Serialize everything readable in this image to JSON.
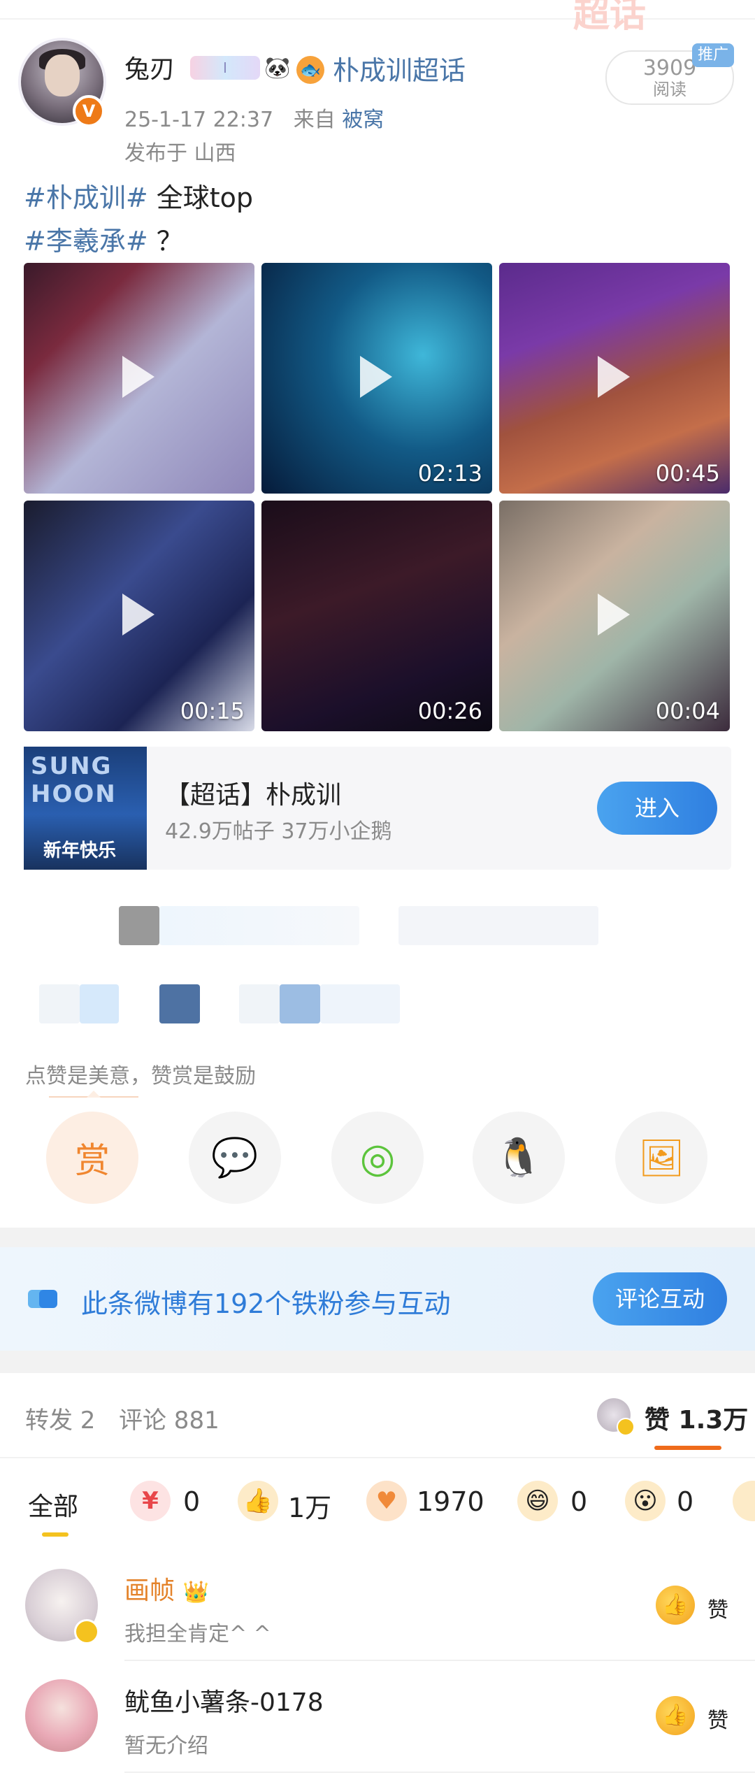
{
  "header": {
    "user_name": "兔刃",
    "tag_chip": "I",
    "panda_emoji": "🐼",
    "fish_emoji": "🐟",
    "super_topic_link": "朴成训超话",
    "timestamp": "25-1-17 22:37",
    "source_prefix": "来自",
    "source_name": "被窝",
    "location": "发布于 山西",
    "read_count": "3909",
    "read_label": "阅读",
    "ad_tag": "推广",
    "verified_mark": "V"
  },
  "post": {
    "line1_hashtag": "#朴成训#",
    "line1_text": " 全球top",
    "line2_hashtag": "#李羲承#",
    "line2_text": "？"
  },
  "videos": [
    {
      "duration": ""
    },
    {
      "duration": "02:13"
    },
    {
      "duration": "00:45"
    },
    {
      "duration": "00:15"
    },
    {
      "duration": "00:26"
    },
    {
      "duration": "00:04"
    }
  ],
  "topic_card": {
    "thumb_text": "SUNG HOON",
    "thumb_banner": "新年快乐",
    "title": "【超话】朴成训",
    "subtitle": "42.9万帖子 37万小企鹅",
    "enter_label": "进入"
  },
  "tip": {
    "text": "点赞是美意，赞赏是鼓励"
  },
  "share": [
    {
      "name": "reward",
      "glyph": "赏"
    },
    {
      "name": "wechat",
      "glyph": "💬"
    },
    {
      "name": "moments",
      "glyph": "◎"
    },
    {
      "name": "qq",
      "glyph": "🐧"
    },
    {
      "name": "save-image",
      "glyph": "🖼"
    }
  ],
  "fan_bar": {
    "text": "此条微博有192个铁粉参与互动",
    "button": "评论互动"
  },
  "tabs": {
    "repost": "转发 2",
    "comment": "评论 881",
    "like": "赞 1.3万"
  },
  "reactions": {
    "all": "全部",
    "items": [
      {
        "emoji": "¥",
        "count": "0",
        "color": "#e8464a"
      },
      {
        "emoji": "👍",
        "count": "1万",
        "color": "#f3a21c"
      },
      {
        "emoji": "♥",
        "count": "1970",
        "color": "#f08a3a"
      },
      {
        "emoji": "😄",
        "count": "0",
        "color": "#f3b51c"
      },
      {
        "emoji": "😮",
        "count": "0",
        "color": "#f3b51c"
      }
    ]
  },
  "likers": [
    {
      "name": "画帧",
      "crown": "👑",
      "desc": "我担全肯定^ ^",
      "like_label": "赞"
    },
    {
      "name": "鱿鱼小薯条-0178",
      "desc": "暂无介绍",
      "like_label": "赞"
    }
  ]
}
